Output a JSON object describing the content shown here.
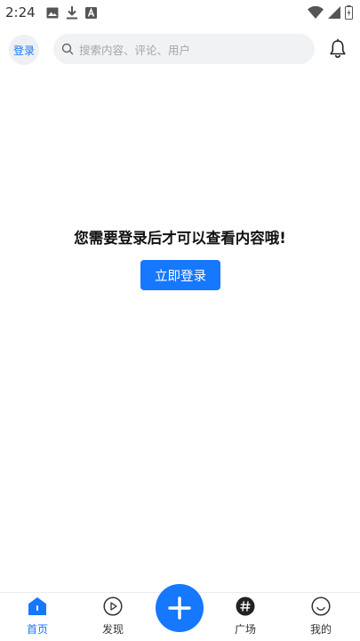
{
  "status_bar": {
    "time": "2:24",
    "left_icons": [
      "image-icon",
      "download-icon",
      "a-letter-icon"
    ],
    "right_icons": [
      "wifi-icon",
      "signal-icon",
      "battery-icon"
    ]
  },
  "header": {
    "login_label": "登录",
    "search_placeholder": "搜索内容、评论、用户",
    "notification_icon": "bell-icon"
  },
  "main": {
    "message": "您需要登录后才可以查看内容哦!",
    "login_button": "立即登录"
  },
  "bottom_nav": {
    "items": [
      {
        "label": "首页",
        "icon": "home-icon",
        "active": true
      },
      {
        "label": "发现",
        "icon": "play-circle-icon",
        "active": false
      },
      {
        "label": "广场",
        "icon": "hashtag-icon",
        "active": false
      },
      {
        "label": "我的",
        "icon": "smiley-icon",
        "active": false
      }
    ],
    "fab_icon": "plus-icon"
  },
  "colors": {
    "accent": "#1677ff",
    "search_bg": "#f1f2f4",
    "placeholder": "#a6a6a6"
  }
}
